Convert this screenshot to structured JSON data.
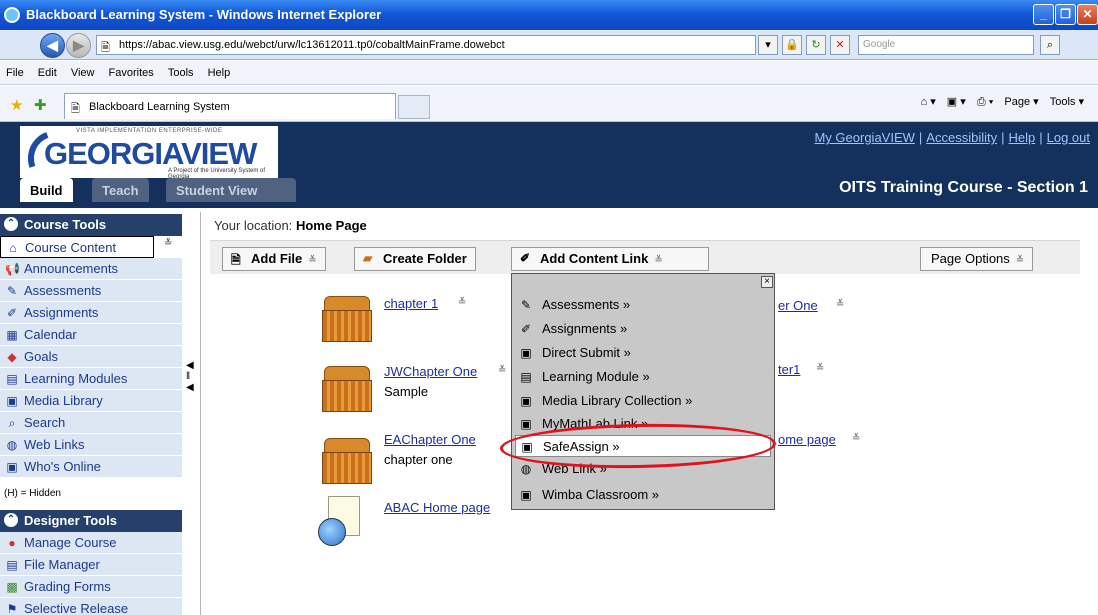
{
  "browser": {
    "title": "Blackboard Learning System - Windows Internet Explorer",
    "url": "https://abac.view.usg.edu/webct/urw/lc13612011.tp0/cobaltMainFrame.dowebct",
    "search_placeholder": "Google",
    "menu": [
      "File",
      "Edit",
      "View",
      "Favorites",
      "Tools",
      "Help"
    ],
    "tab_label": "Blackboard Learning System",
    "commands": [
      "Page ▾",
      "Tools ▾"
    ]
  },
  "header": {
    "logo_tagline": "VISTA IMPLEMENTATION ENTERPRISE-WIDE",
    "logo_word": "GEORGIAVIEW",
    "logo_sub": "A Project of the University System of Georgia",
    "links": [
      "My GeorgiaVIEW",
      "Accessibility",
      "Help",
      "Log out"
    ],
    "course_title": "OITS Training Course - Section 1",
    "mode_tabs": [
      "Build",
      "Teach",
      "Student View"
    ]
  },
  "course_tools": {
    "heading": "Course Tools",
    "items": [
      {
        "label": "Course Content",
        "icon": "home-icon"
      },
      {
        "label": "Announcements",
        "icon": "megaphone-icon"
      },
      {
        "label": "Assessments",
        "icon": "assessment-icon"
      },
      {
        "label": "Assignments",
        "icon": "assignment-icon"
      },
      {
        "label": "Calendar",
        "icon": "calendar-icon"
      },
      {
        "label": "Goals",
        "icon": "goals-icon"
      },
      {
        "label": "Learning Modules",
        "icon": "module-icon"
      },
      {
        "label": "Media Library",
        "icon": "media-icon"
      },
      {
        "label": "Search",
        "icon": "search-icon"
      },
      {
        "label": "Web Links",
        "icon": "globe-icon"
      },
      {
        "label": "Who's Online",
        "icon": "people-icon"
      }
    ],
    "hidden_note": "(H) = Hidden"
  },
  "designer_tools": {
    "heading": "Designer Tools",
    "items": [
      {
        "label": "Manage Course",
        "icon": "manage-icon"
      },
      {
        "label": "File Manager",
        "icon": "file-manager-icon"
      },
      {
        "label": "Grading Forms",
        "icon": "grading-icon"
      },
      {
        "label": "Selective Release",
        "icon": "release-icon"
      }
    ]
  },
  "main": {
    "location_label": "Your location:",
    "location_value": "Home Page",
    "toolbar": {
      "add_file": "Add File",
      "create_folder": "Create Folder",
      "add_content_link": "Add Content Link",
      "page_options": "Page Options"
    },
    "items": [
      {
        "title": "chapter 1",
        "desc": ""
      },
      {
        "title": "JWChapter One",
        "desc": "Sample"
      },
      {
        "title": "EAChapter One",
        "desc": "chapter one"
      },
      {
        "title": "ABAC Home page",
        "desc": ""
      }
    ],
    "right_items": [
      "er One",
      "ter1",
      "ome page"
    ]
  },
  "dropdown": {
    "items": [
      {
        "label": "Assessments »",
        "icon": "assessment-icon"
      },
      {
        "label": "Assignments »",
        "icon": "assignment-icon"
      },
      {
        "label": "Direct Submit »",
        "icon": "direct-submit-icon"
      },
      {
        "label": "Learning Module »",
        "icon": "module-icon"
      },
      {
        "label": "Media Library Collection »",
        "icon": "media-icon"
      },
      {
        "label": "MyMathLab Link »",
        "icon": "mathlab-icon"
      },
      {
        "label": "SafeAssign »",
        "icon": "safeassign-icon"
      },
      {
        "label": "Web Link »",
        "icon": "globe-icon"
      },
      {
        "label": "Wimba Classroom »",
        "icon": "wimba-icon"
      }
    ],
    "highlighted": "SafeAssign »",
    "annotation_color": "#e0121b"
  }
}
